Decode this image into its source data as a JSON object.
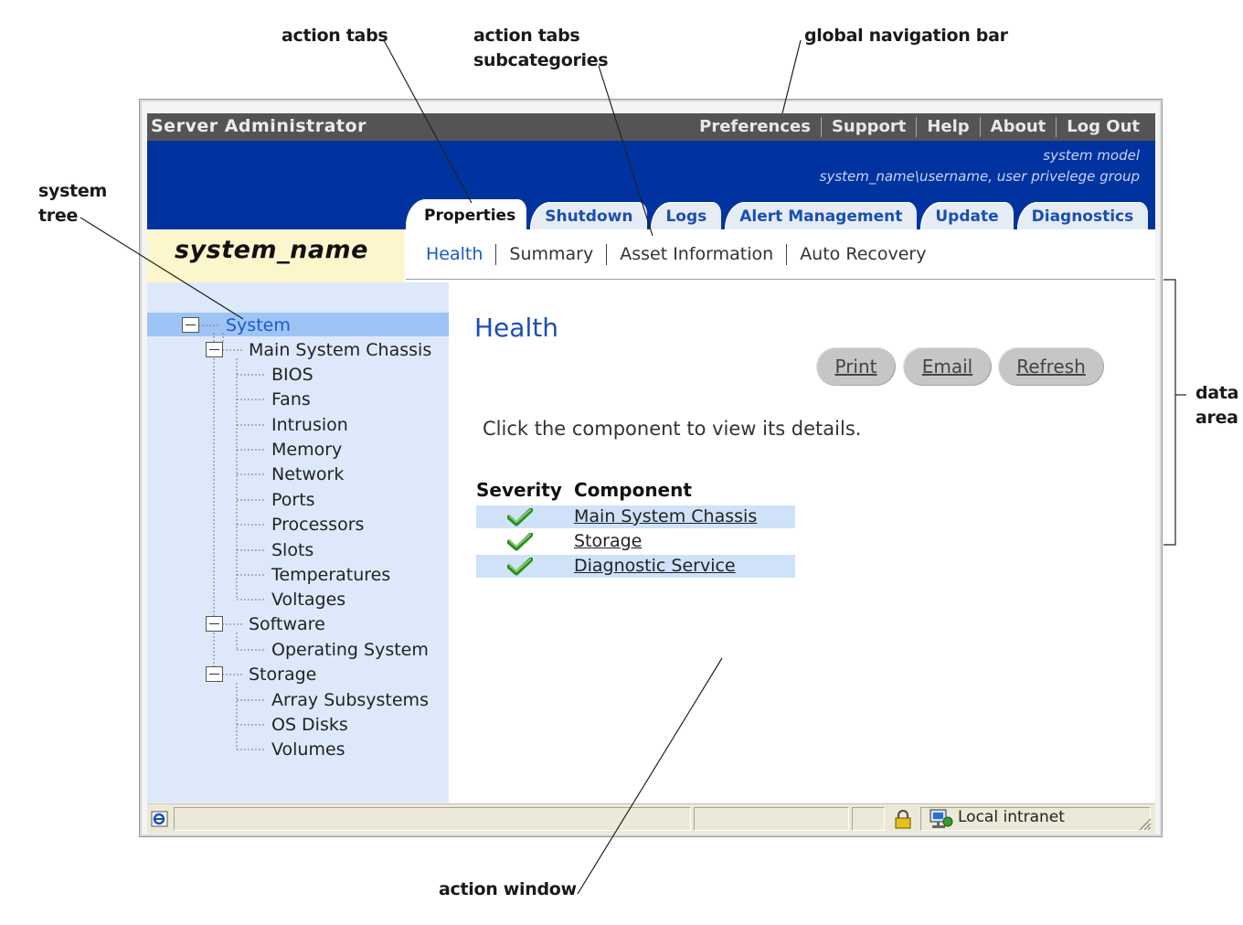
{
  "annotations": {
    "action_tabs": "action tabs",
    "action_tabs_sub_line1": "action tabs",
    "action_tabs_sub_line2": "subcategories",
    "global_nav_bar": "global navigation bar",
    "system_tree_line1": "system",
    "system_tree_line2": "tree",
    "data_area_line1": "data",
    "data_area_line2": "area",
    "action_window": "action window"
  },
  "app": {
    "title": "Server Administrator"
  },
  "global_nav": {
    "items": [
      "Preferences",
      "Support",
      "Help",
      "About",
      "Log Out"
    ]
  },
  "user_info": {
    "line1": "system model",
    "line2": "system_name\\username, user privelege group"
  },
  "system_name": "system_name",
  "action_tabs": {
    "items": [
      "Properties",
      "Shutdown",
      "Logs",
      "Alert Management",
      "Update",
      "Diagnostics"
    ],
    "active": "Properties"
  },
  "subtabs": {
    "items": [
      "Health",
      "Summary",
      "Asset Information",
      "Auto Recovery"
    ],
    "active": "Health"
  },
  "tree": {
    "root": "System",
    "chassis": "Main System Chassis",
    "chassis_children": [
      "BIOS",
      "Fans",
      "Intrusion",
      "Memory",
      "Network",
      "Ports",
      "Processors",
      "Slots",
      "Temperatures",
      "Voltages"
    ],
    "software": "Software",
    "software_children": [
      "Operating System"
    ],
    "storage": "Storage",
    "storage_children": [
      "Array Subsystems",
      "OS Disks",
      "Volumes"
    ]
  },
  "data": {
    "title": "Health",
    "buttons": [
      "Print",
      "Email",
      "Refresh"
    ],
    "instructions": "Click the component to view its details.",
    "table_headers": [
      "Severity",
      "Component"
    ],
    "rows": [
      {
        "severity": "ok",
        "component": "Main System Chassis"
      },
      {
        "severity": "ok",
        "component": "Storage"
      },
      {
        "severity": "ok",
        "component": "Diagnostic Service"
      }
    ]
  },
  "status_bar": {
    "zone": "Local intranet"
  },
  "colors": {
    "global_bar": "#545454",
    "brand_blue": "#0033a0",
    "tree_bg": "#dde9fb",
    "sysname_bg": "#fbf6cc",
    "ok_green": "#3a9a2a"
  }
}
